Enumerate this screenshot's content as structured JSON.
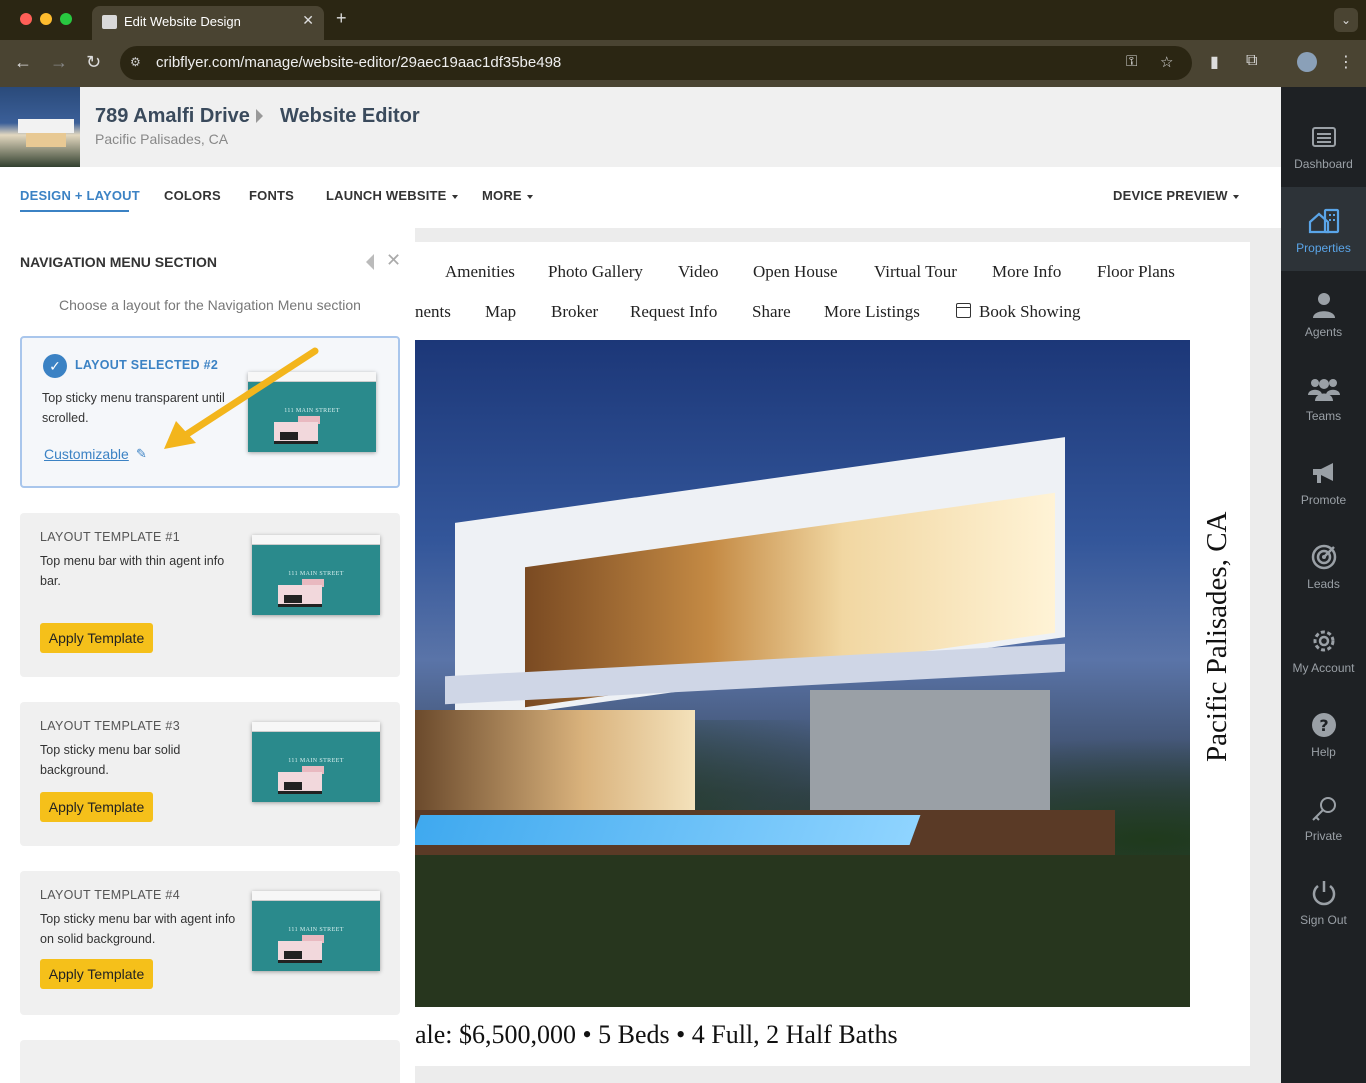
{
  "browser": {
    "tab_title": "Edit Website Design",
    "url": "cribflyer.com/manage/website-editor/29aec19aac1df35be498"
  },
  "header": {
    "property_title": "789 Amalfi Drive",
    "breadcrumb_current": "Website Editor",
    "property_location": "Pacific Palisades, CA"
  },
  "toolbar": {
    "design_layout": "DESIGN + LAYOUT",
    "colors": "COLORS",
    "fonts": "FONTS",
    "launch_website": "LAUNCH WEBSITE",
    "more": "MORE",
    "device_preview": "DEVICE PREVIEW"
  },
  "panel": {
    "title": "NAVIGATION MENU SECTION",
    "hint": "Choose a layout for the Navigation Menu section",
    "selected": {
      "label": "LAYOUT SELECTED #2",
      "description": "Top sticky menu transparent until scrolled.",
      "customize_link": "Customizable"
    },
    "templates": [
      {
        "label": "LAYOUT TEMPLATE #1",
        "description": "Top menu bar with thin agent info bar.",
        "button": "Apply Template"
      },
      {
        "label": "LAYOUT TEMPLATE #3",
        "description": "Top sticky menu bar solid background.",
        "button": "Apply Template"
      },
      {
        "label": "LAYOUT TEMPLATE #4",
        "description": "Top sticky menu bar with agent info on solid background.",
        "button": "Apply Template"
      }
    ],
    "preview_caption": "111 MAIN STREET"
  },
  "site": {
    "menu_row1": [
      "Amenities",
      "Photo Gallery",
      "Video",
      "Open House",
      "Virtual Tour",
      "More Info",
      "Floor Plans"
    ],
    "menu_row2": [
      "nents",
      "Map",
      "Broker",
      "Request Info",
      "Share",
      "More Listings",
      "Book Showing"
    ],
    "side_location": "Pacific Palisades, CA",
    "price_line": "ale: $6,500,000 • 5 Beds • 4 Full, 2 Half Baths"
  },
  "sidebar": {
    "items": [
      {
        "label": "Dashboard",
        "icon": "dashboard-icon"
      },
      {
        "label": "Properties",
        "icon": "properties-icon"
      },
      {
        "label": "Agents",
        "icon": "agent-icon"
      },
      {
        "label": "Teams",
        "icon": "teams-icon"
      },
      {
        "label": "Promote",
        "icon": "megaphone-icon"
      },
      {
        "label": "Leads",
        "icon": "target-icon"
      },
      {
        "label": "My Account",
        "icon": "gear-icon"
      },
      {
        "label": "Help",
        "icon": "help-icon"
      },
      {
        "label": "Private",
        "icon": "key-icon"
      },
      {
        "label": "Sign Out",
        "icon": "power-icon"
      }
    ]
  },
  "colors": {
    "accent": "#3b82c4",
    "button_yellow": "#f5c01a",
    "sidebar_bg": "#1e2124"
  }
}
